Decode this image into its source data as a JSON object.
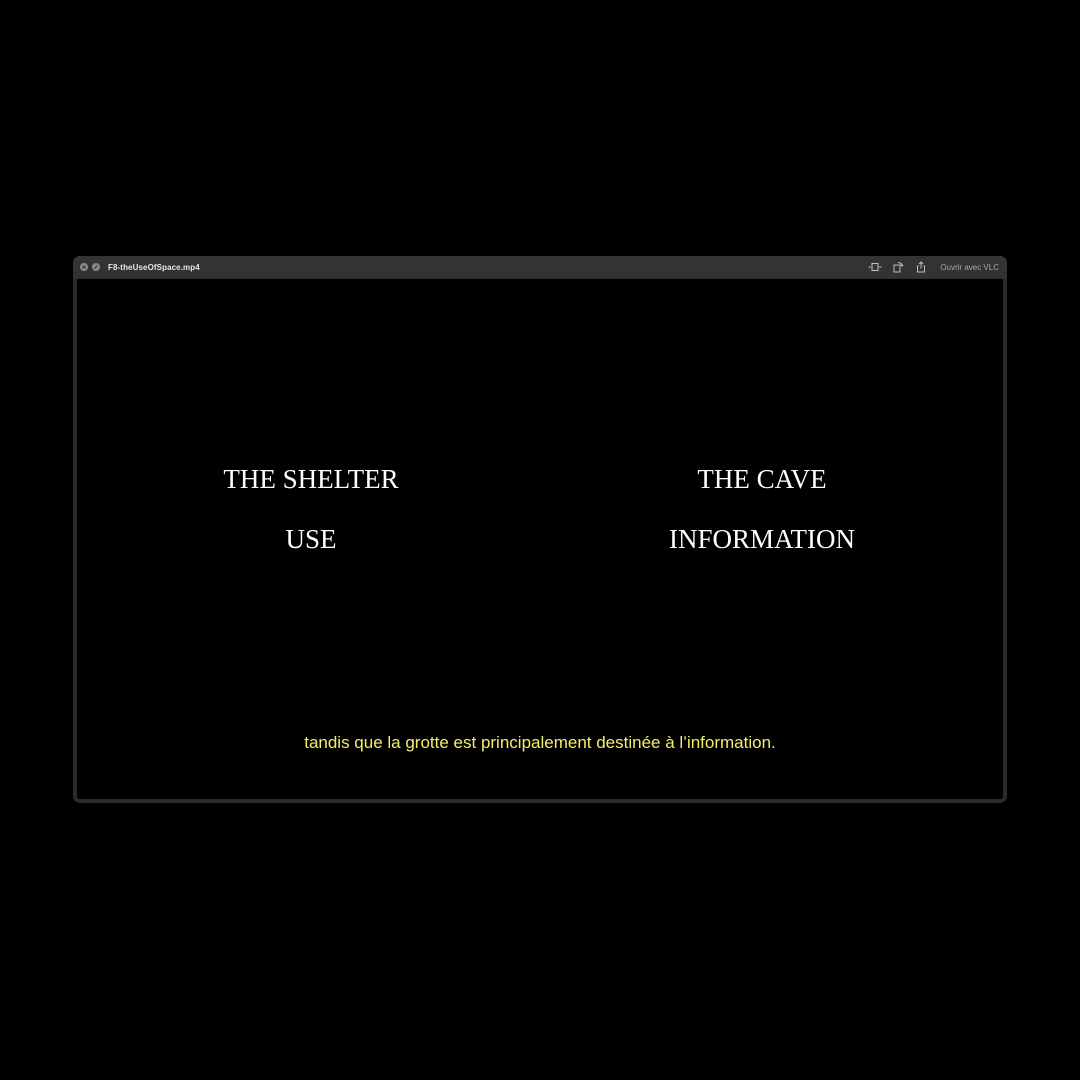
{
  "window": {
    "title": "F8-theUseOfSpace.mp4",
    "close_icon": "close-icon",
    "fullscreen_icon": "fullscreen-icon",
    "open_with_label": "Ouvrir avec VLC",
    "toolbar_icons": [
      "trim-icon",
      "rotate-icon",
      "share-icon"
    ]
  },
  "video": {
    "left_top_word": "THE SHELTER",
    "left_bottom_word": "USE",
    "right_top_word": "THE CAVE",
    "right_bottom_word": "INFORMATION",
    "subtitle": "tandis que la grotte est principalement destinée à l’information."
  },
  "colors": {
    "background": "#000000",
    "titlebar": "#333333",
    "subtitle": "#f2ee6a",
    "text": "#ffffff"
  }
}
